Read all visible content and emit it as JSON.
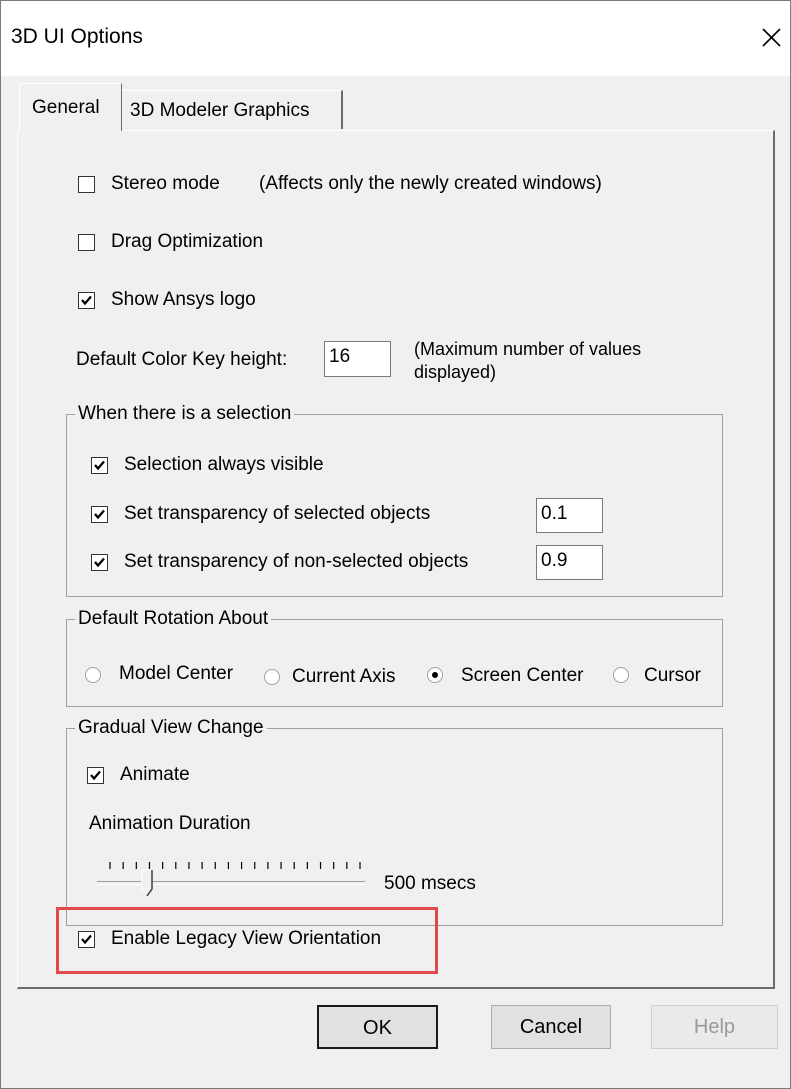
{
  "window": {
    "title": "3D UI Options"
  },
  "tabs": [
    {
      "label": "General",
      "selected": true
    },
    {
      "label": "3D Modeler Graphics",
      "selected": false
    }
  ],
  "general": {
    "stereo_mode": {
      "label": "Stereo mode",
      "checked": false,
      "note": "(Affects only the newly created windows)"
    },
    "drag_optimization": {
      "label": "Drag Optimization",
      "checked": false
    },
    "show_logo": {
      "label": "Show Ansys logo",
      "checked": true
    },
    "color_key": {
      "label": "Default Color Key height:",
      "value": "16",
      "note_line1": "(Maximum number of values",
      "note_line2": "displayed)"
    }
  },
  "selection_group": {
    "title": "When there is a selection",
    "always_visible": {
      "label": "Selection always visible",
      "checked": true
    },
    "transparency_selected": {
      "label": "Set transparency of selected objects",
      "checked": true,
      "value": "0.1"
    },
    "transparency_nonselected": {
      "label": "Set transparency of non-selected objects",
      "checked": true,
      "value": "0.9"
    }
  },
  "rotation_group": {
    "title": "Default Rotation About",
    "options": [
      {
        "label": "Model Center",
        "selected": false
      },
      {
        "label": "Current Axis",
        "selected": false
      },
      {
        "label": "Screen Center",
        "selected": true
      },
      {
        "label": "Cursor",
        "selected": false
      }
    ]
  },
  "view_change_group": {
    "title": "Gradual View Change",
    "animate": {
      "label": "Animate",
      "checked": true
    },
    "duration_label": "Animation Duration",
    "duration_value": "500 msecs",
    "slider_fraction": 0.15
  },
  "legacy_orientation": {
    "label": "Enable Legacy View Orientation",
    "checked": true
  },
  "buttons": {
    "ok": "OK",
    "cancel": "Cancel",
    "help": "Help"
  },
  "colors": {
    "highlight_border": "#e04a4a",
    "dialog_bg": "#f0f0f0"
  }
}
